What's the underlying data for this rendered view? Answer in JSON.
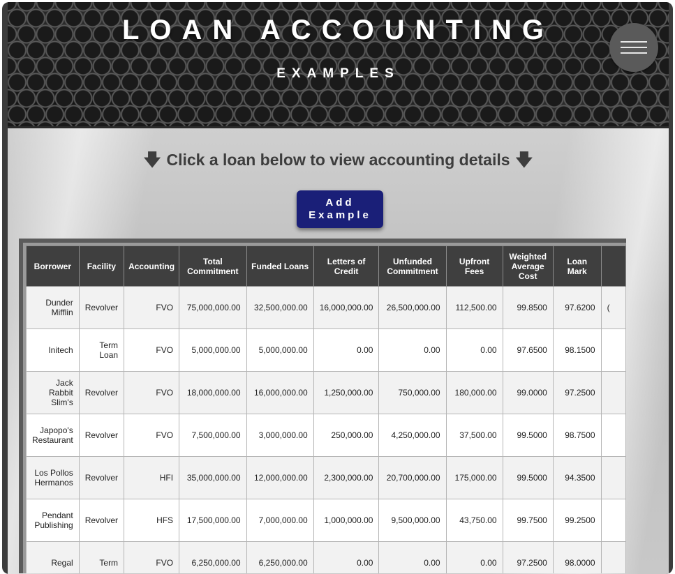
{
  "header": {
    "title": "LOAN ACCOUNTING",
    "subtitle": "EXAMPLES",
    "menu_icon": "hamburger-menu-icon"
  },
  "main": {
    "instruction": "Click a loan below to view accounting details",
    "arrow_icon": "down-arrow-icon",
    "add_button_line1": "Add",
    "add_button_line2": "Example"
  },
  "table": {
    "columns": [
      "Borrower",
      "Facility",
      "Accounting",
      "Total Commitment",
      "Funded Loans",
      "Letters of Credit",
      "Unfunded Commitment",
      "Upfront Fees",
      "Weighted Average Cost",
      "Loan Mark",
      ""
    ],
    "rows": [
      [
        "Dunder Mifflin",
        "Revolver",
        "FVO",
        "75,000,000.00",
        "32,500,000.00",
        "16,000,000.00",
        "26,500,000.00",
        "112,500.00",
        "99.8500",
        "97.6200",
        "("
      ],
      [
        "Initech",
        "Term Loan",
        "FVO",
        "5,000,000.00",
        "5,000,000.00",
        "0.00",
        "0.00",
        "0.00",
        "97.6500",
        "98.1500",
        ""
      ],
      [
        "Jack Rabbit Slim's",
        "Revolver",
        "FVO",
        "18,000,000.00",
        "16,000,000.00",
        "1,250,000.00",
        "750,000.00",
        "180,000.00",
        "99.0000",
        "97.2500",
        ""
      ],
      [
        "Japopo's Restaurant",
        "Revolver",
        "FVO",
        "7,500,000.00",
        "3,000,000.00",
        "250,000.00",
        "4,250,000.00",
        "37,500.00",
        "99.5000",
        "98.7500",
        ""
      ],
      [
        "Los Pollos Hermanos",
        "Revolver",
        "HFI",
        "35,000,000.00",
        "12,000,000.00",
        "2,300,000.00",
        "20,700,000.00",
        "175,000.00",
        "99.5000",
        "94.3500",
        ""
      ],
      [
        "Pendant Publishing",
        "Revolver",
        "HFS",
        "17,500,000.00",
        "7,000,000.00",
        "1,000,000.00",
        "9,500,000.00",
        "43,750.00",
        "99.7500",
        "99.2500",
        ""
      ],
      [
        "Regal",
        "Term",
        "FVO",
        "6,250,000.00",
        "6,250,000.00",
        "0.00",
        "0.00",
        "0.00",
        "97.2500",
        "98.0000",
        ""
      ]
    ]
  }
}
